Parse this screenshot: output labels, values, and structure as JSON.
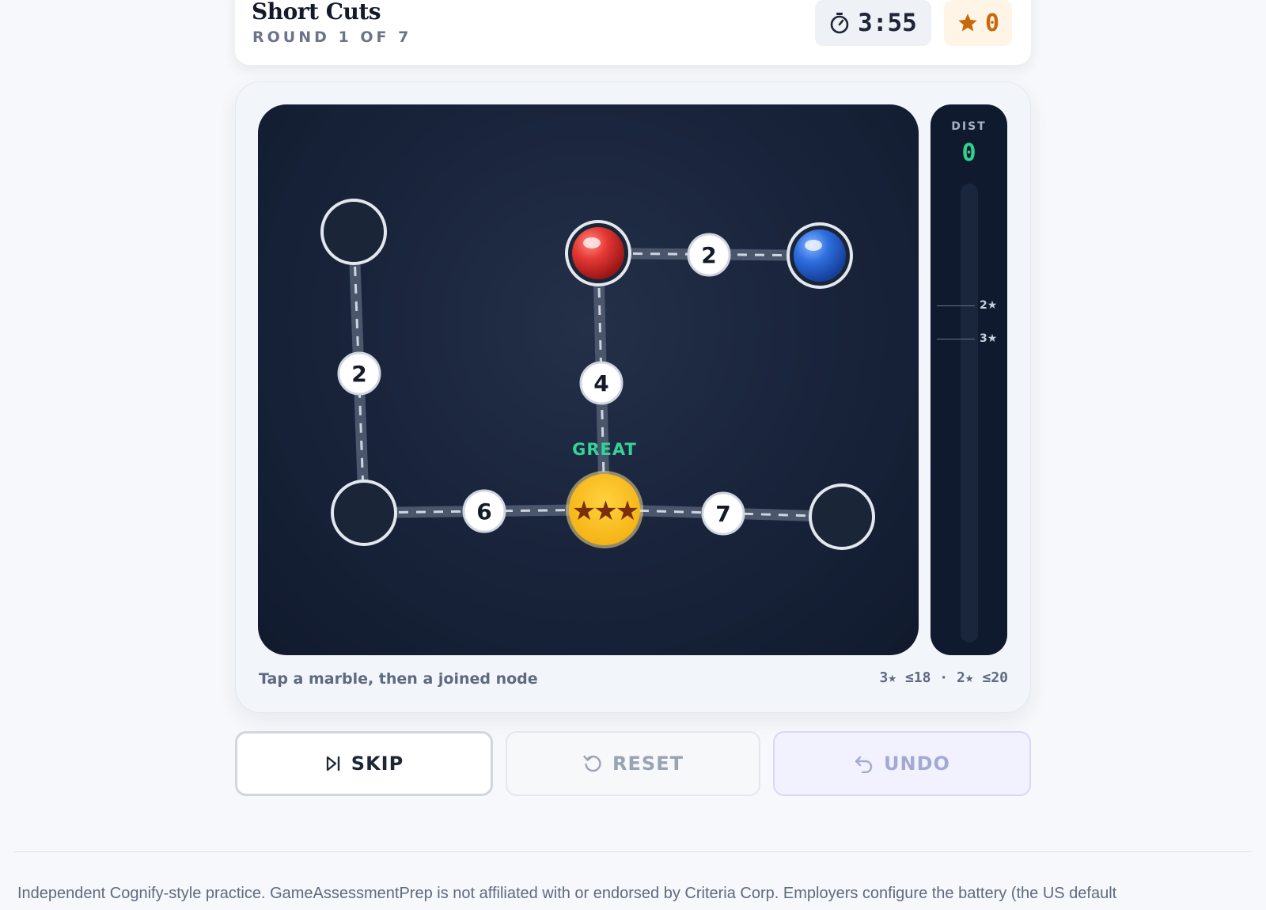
{
  "header": {
    "title": "Short Cuts",
    "round": "ROUND 1 OF 7",
    "timer": "3:55",
    "score": "0"
  },
  "board": {
    "edge_weights": [
      "2",
      "2",
      "4",
      "6",
      "7"
    ],
    "feedback": "GREAT",
    "marbles": {
      "red": "#e53935",
      "blue": "#2f6fe0"
    },
    "target_stars": "★★★"
  },
  "dist_panel": {
    "label": "DIST",
    "value": "0",
    "threshold_labels": [
      "2★",
      "3★"
    ]
  },
  "hint": "Tap a marble, then a joined node",
  "thresholds": "3★ ≤18 · 2★ ≤20",
  "buttons": {
    "skip": "SKIP",
    "reset": "RESET",
    "undo": "UNDO"
  },
  "footer": "Independent Cognify-style practice. GameAssessmentPrep is not affiliated with or endorsed by Criteria Corp. Employers configure the battery (the US default"
}
